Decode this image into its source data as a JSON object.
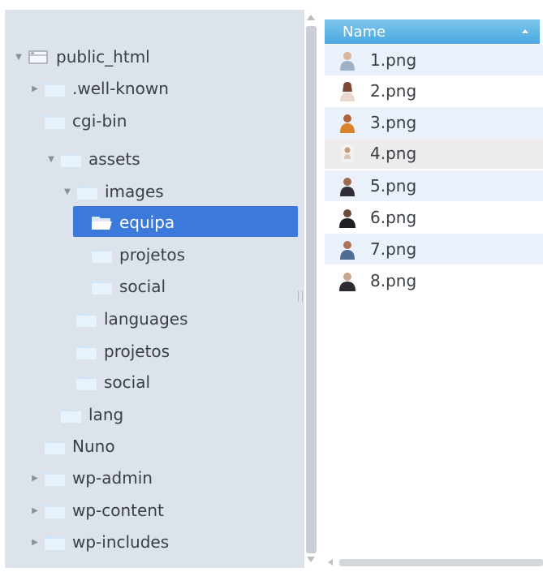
{
  "tree": {
    "items": [
      {
        "label": "public_html",
        "depth": 0,
        "expander": "expanded",
        "icon": "server-icon"
      },
      {
        "label": ".well-known",
        "depth": 1,
        "expander": "collapsed",
        "icon": "folder-icon"
      },
      {
        "label": "cgi-bin",
        "depth": 1,
        "expander": "none",
        "icon": "folder-icon"
      },
      {
        "label": "assets",
        "depth": 1,
        "expander": "expanded",
        "icon": "folder-icon"
      },
      {
        "label": "images",
        "depth": 2,
        "expander": "expanded",
        "icon": "folder-icon"
      },
      {
        "label": "equipa",
        "depth": 3,
        "expander": "none",
        "icon": "open-folder-icon",
        "selected": true
      },
      {
        "label": "projetos",
        "depth": 3,
        "expander": "none",
        "icon": "folder-icon"
      },
      {
        "label": "social",
        "depth": 3,
        "expander": "none",
        "icon": "folder-icon"
      },
      {
        "label": "languages",
        "depth": 2,
        "expander": "none",
        "icon": "folder-icon"
      },
      {
        "label": "projetos",
        "depth": 2,
        "expander": "none",
        "icon": "folder-icon"
      },
      {
        "label": "social",
        "depth": 2,
        "expander": "none",
        "icon": "folder-icon"
      },
      {
        "label": "lang",
        "depth": 1,
        "expander": "none",
        "icon": "folder-icon"
      },
      {
        "label": "Nuno",
        "depth": 1,
        "expander": "none",
        "icon": "folder-icon"
      },
      {
        "label": "wp-admin",
        "depth": 1,
        "expander": "collapsed",
        "icon": "folder-icon"
      },
      {
        "label": "wp-content",
        "depth": 1,
        "expander": "collapsed",
        "icon": "folder-icon"
      },
      {
        "label": "wp-includes",
        "depth": 1,
        "expander": "collapsed",
        "icon": "folder-icon"
      }
    ]
  },
  "file_list": {
    "column_header": "Name",
    "sort": "ascending",
    "files": [
      {
        "name": "1.png",
        "icon": "person-thumbnail-icon"
      },
      {
        "name": "2.png",
        "icon": "person-thumbnail-icon"
      },
      {
        "name": "3.png",
        "icon": "person-thumbnail-icon"
      },
      {
        "name": "4.png",
        "icon": "person-thumbnail-icon"
      },
      {
        "name": "5.png",
        "icon": "person-thumbnail-icon"
      },
      {
        "name": "6.png",
        "icon": "person-thumbnail-icon"
      },
      {
        "name": "7.png",
        "icon": "person-thumbnail-icon"
      },
      {
        "name": "8.png",
        "icon": "person-thumbnail-icon"
      }
    ]
  },
  "colors": {
    "selection": "#3b7adb",
    "tree_background": "#dde3ea",
    "header_gradient_top": "#7ec6ec",
    "header_gradient_bottom": "#4aa9e0",
    "alternate_row": "#eaf1fb"
  }
}
